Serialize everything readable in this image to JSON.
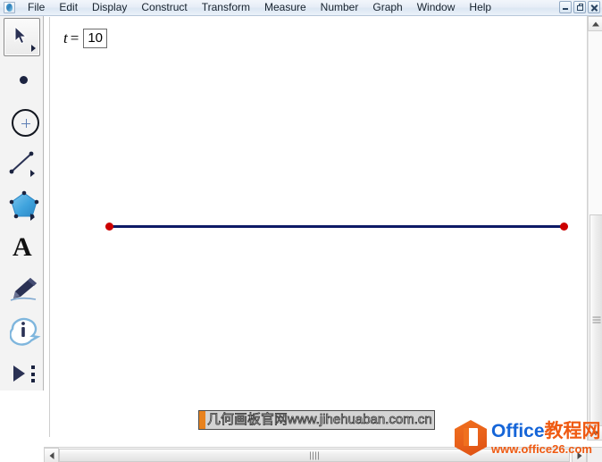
{
  "window": {
    "app_icon": "sketchpad-icon",
    "controls": {
      "minimize": "minimize-icon",
      "restore": "restore-icon",
      "close": "close-icon"
    }
  },
  "menubar": {
    "items": [
      {
        "label": "File"
      },
      {
        "label": "Edit"
      },
      {
        "label": "Display"
      },
      {
        "label": "Construct"
      },
      {
        "label": "Transform"
      },
      {
        "label": "Measure"
      },
      {
        "label": "Number"
      },
      {
        "label": "Graph"
      },
      {
        "label": "Window"
      },
      {
        "label": "Help"
      }
    ]
  },
  "toolbar": {
    "tools": [
      {
        "name": "arrow-select-tool",
        "icon": "arrow-cursor-icon",
        "selected": true,
        "has_flyout": true
      },
      {
        "name": "point-tool",
        "icon": "point-icon",
        "selected": false,
        "has_flyout": false
      },
      {
        "name": "compass-tool",
        "icon": "circle-icon",
        "selected": false,
        "has_flyout": false
      },
      {
        "name": "straightedge-tool",
        "icon": "line-segment-icon",
        "selected": false,
        "has_flyout": true
      },
      {
        "name": "polygon-tool",
        "icon": "pentagon-icon",
        "selected": false,
        "has_flyout": true
      },
      {
        "name": "text-tool",
        "icon": "letter-a-icon",
        "selected": false,
        "has_flyout": false
      },
      {
        "name": "marker-tool",
        "icon": "pen-icon",
        "selected": false,
        "has_flyout": false
      },
      {
        "name": "information-tool",
        "icon": "info-bubble-icon",
        "selected": false,
        "has_flyout": false
      },
      {
        "name": "custom-tool",
        "icon": "play-triangle-icon",
        "selected": false,
        "has_flyout": false
      }
    ]
  },
  "canvas": {
    "parameter": {
      "variable": "t",
      "equals": "=",
      "value": "10"
    },
    "segment": {
      "name": "line-segment",
      "color": "#0d1a66",
      "endpoint_color": "#cc0000"
    },
    "watermark": {
      "text": "几何画板官网www.jihehuaban.com.cn",
      "accent_color": "#e8821e"
    }
  },
  "scrollbars": {
    "vertical": {
      "up": "scroll-up-icon",
      "down": "scroll-down-icon"
    },
    "horizontal": {
      "left": "scroll-left-icon",
      "right": "scroll-right-icon"
    }
  },
  "office_watermark": {
    "brand_en": "Office",
    "brand_cn": "教程网",
    "url": "www.office26.com",
    "blue": "#1565d8",
    "orange": "#ef5a12"
  }
}
